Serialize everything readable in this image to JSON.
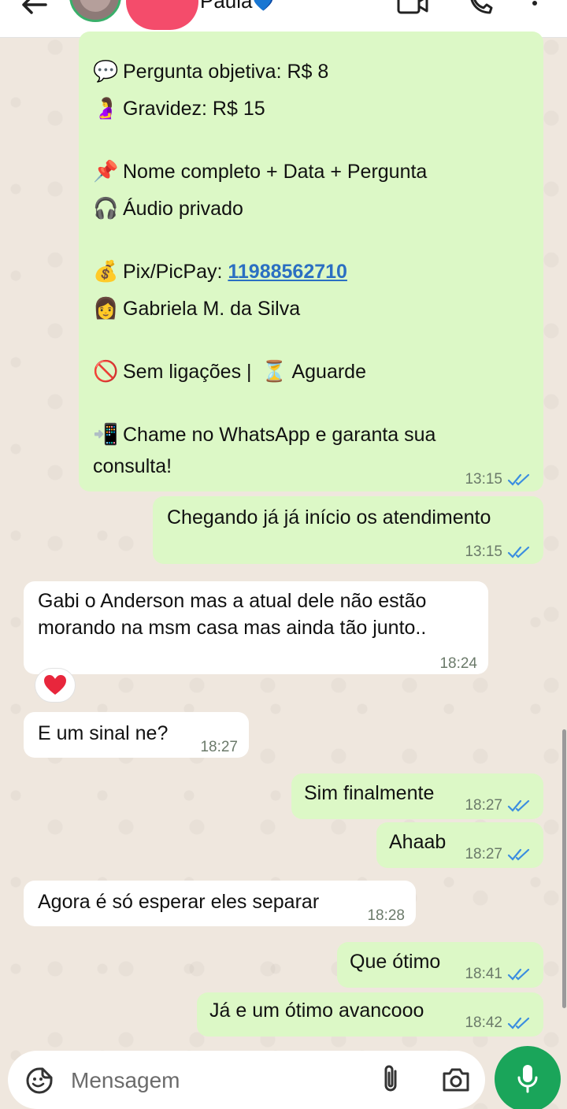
{
  "header": {
    "contact_name": "Paula",
    "contact_emoji": "💙"
  },
  "promo_message": {
    "lines": [
      {
        "emoji": "💬",
        "text": "Pergunta objetiva: R$ 8"
      },
      {
        "emoji": "🤰",
        "text": "Gravidez: R$ 15"
      },
      {
        "emoji": "📌",
        "text": "Nome completo + Data + Pergunta"
      },
      {
        "emoji": "🎧",
        "text": "Áudio privado"
      },
      {
        "emoji": "💰",
        "text": "Pix/PicPay: ",
        "link": "11988562710"
      },
      {
        "emoji": "👩",
        "text": "Gabriela M. da Silva"
      },
      {
        "emoji": "🚫",
        "text": "Sem ligações | ",
        "emoji2": "⏳",
        "text2": "Aguarde"
      },
      {
        "emoji": "📲",
        "text": "Chame no WhatsApp e garanta sua"
      },
      {
        "text": "consulta!"
      }
    ],
    "time": "13:15"
  },
  "messages": [
    {
      "dir": "out",
      "text": "Chegando já já início os atendimento",
      "time": "13:15"
    },
    {
      "dir": "in",
      "text": "Gabi o Anderson mas a atual dele não estão",
      "text_line2": "morando na msm casa mas ainda tão junto..",
      "time": "18:24",
      "reaction": "❤️"
    },
    {
      "dir": "in",
      "text": "E um sinal ne?",
      "time": "18:27"
    },
    {
      "dir": "out",
      "text": "Sim finalmente",
      "time": "18:27"
    },
    {
      "dir": "out",
      "text": "Ahaab",
      "time": "18:27"
    },
    {
      "dir": "in",
      "text": "Agora é só esperar eles separar",
      "time": "18:28"
    },
    {
      "dir": "out",
      "text": "Que ótimo",
      "time": "18:41"
    },
    {
      "dir": "out",
      "text": "Já e um ótimo avancooo",
      "time": "18:42"
    }
  ],
  "composer": {
    "placeholder": "Mensagem"
  },
  "icons": {
    "back": "arrow-left-icon",
    "video": "video-call-icon",
    "call": "phone-icon",
    "menu": "more-vertical-icon",
    "emoji": "sticker-icon",
    "attach": "paperclip-icon",
    "camera": "camera-icon",
    "mic": "microphone-icon",
    "read": "double-check-icon"
  },
  "colors": {
    "outgoing": "#dcf8c6",
    "incoming": "#ffffff",
    "tick_blue": "#3b8de0",
    "mic_green": "#1aa55a"
  }
}
